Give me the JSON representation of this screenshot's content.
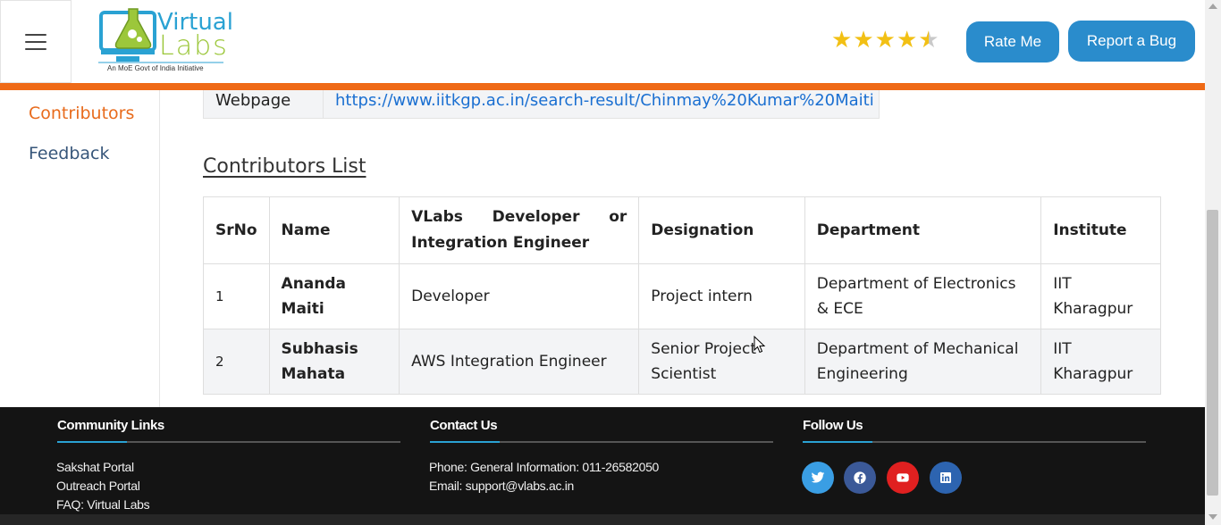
{
  "header": {
    "menu_icon": "hamburger-menu-icon",
    "logo": {
      "name_top": "Virtual",
      "name_bottom": "Labs",
      "tagline": "An MoE Govt of India Initiative"
    },
    "rating": {
      "value": 4.5,
      "max": 5,
      "color": "#f2c014"
    },
    "rate_me_label": "Rate Me",
    "report_bug_label": "Report a Bug",
    "accent_color": "#ef6a17",
    "button_color": "#2a8ccc"
  },
  "sidebar": {
    "items": [
      {
        "label": "Contributors",
        "active": true,
        "color": "#e86b1c"
      },
      {
        "label": "Feedback",
        "active": false,
        "color": "#37567a"
      }
    ]
  },
  "main": {
    "webpage_row": {
      "key": "Webpage",
      "value": "https://www.iitkgp.ac.in/search-result/Chinmay%20Kumar%20Maiti"
    },
    "contributors_list_title": "Contributors List",
    "table": {
      "headers": {
        "srno": "SrNo",
        "name": "Name",
        "role_word1": "VLabs",
        "role_word2": "Developer",
        "role_word3": "or",
        "role_line2": "Integration Engineer",
        "designation": "Designation",
        "department": "Department",
        "institute": "Institute"
      },
      "rows": [
        {
          "srno": "1",
          "name": "Ananda Maiti",
          "role": "Developer",
          "designation": "Project intern",
          "department": "Department of Electronics & ECE",
          "institute": "IIT Kharagpur"
        },
        {
          "srno": "2",
          "name": "Subhasis Mahata",
          "role": "AWS Integration Engineer",
          "designation": "Senior Project Scientist",
          "department": "Department of Mechanical Engineering",
          "institute": "IIT Kharagpur"
        }
      ]
    }
  },
  "footer": {
    "community": {
      "title": "Community Links",
      "links": [
        "Sakshat Portal",
        "Outreach Portal",
        "FAQ: Virtual Labs"
      ]
    },
    "contact": {
      "title": "Contact Us",
      "phone": "Phone: General Information: 011-26582050",
      "email": "Email: support@vlabs.ac.in"
    },
    "follow": {
      "title": "Follow Us",
      "socials": [
        {
          "icon": "twitter-icon",
          "color": "#3a9ee4"
        },
        {
          "icon": "facebook-icon",
          "color": "#3b5998"
        },
        {
          "icon": "youtube-icon",
          "color": "#e02020"
        },
        {
          "icon": "linkedin-icon",
          "color": "#2d64b0"
        }
      ]
    }
  }
}
